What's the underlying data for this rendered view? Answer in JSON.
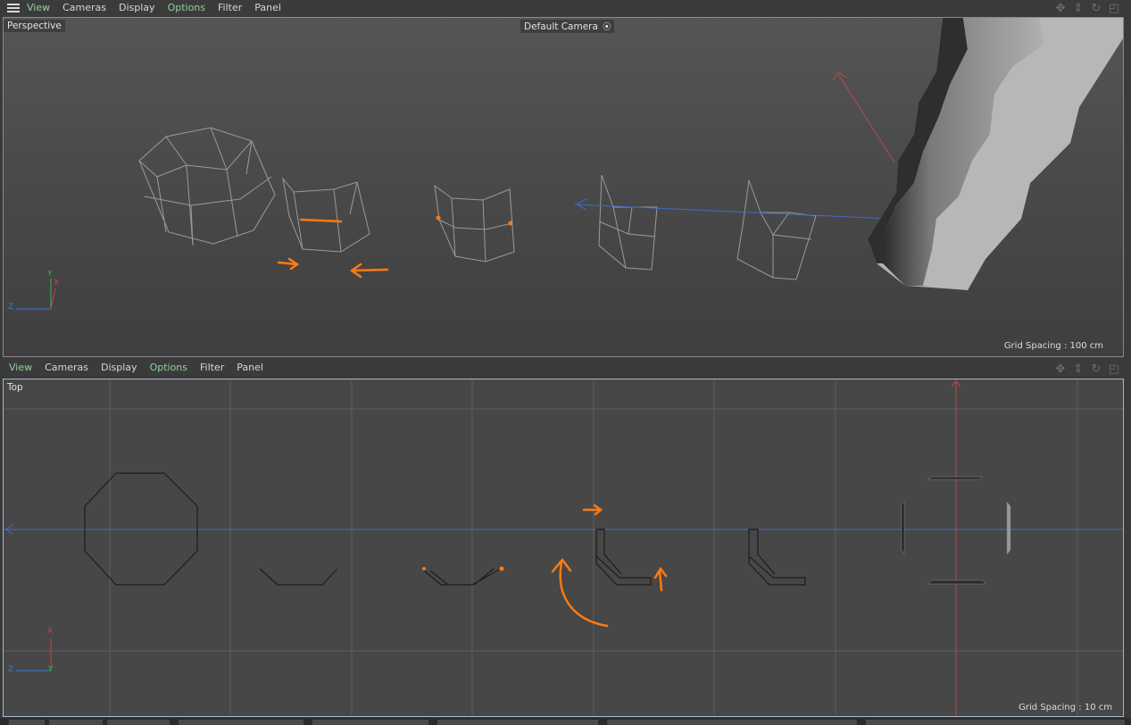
{
  "top_menu": {
    "items": [
      {
        "label": "View",
        "active": true
      },
      {
        "label": "Cameras",
        "active": false
      },
      {
        "label": "Display",
        "active": false
      },
      {
        "label": "Options",
        "active": true
      },
      {
        "label": "Filter",
        "active": false
      },
      {
        "label": "Panel",
        "active": false
      }
    ]
  },
  "bottom_menu": {
    "items": [
      {
        "label": "View",
        "active": true
      },
      {
        "label": "Cameras",
        "active": false
      },
      {
        "label": "Display",
        "active": false
      },
      {
        "label": "Options",
        "active": true
      },
      {
        "label": "Filter",
        "active": false
      },
      {
        "label": "Panel",
        "active": false
      }
    ]
  },
  "perspective": {
    "label": "Perspective",
    "camera": "Default Camera",
    "grid_spacing": "Grid Spacing : 100 cm",
    "axis": {
      "y": "Y",
      "x": "X",
      "z": "Z"
    }
  },
  "top_view": {
    "label": "Top",
    "grid_spacing": "Grid Spacing : 10 cm",
    "axis": {
      "x": "X",
      "y": "Y",
      "z": "Z"
    }
  },
  "colors": {
    "accent_orange": "#ff7a12",
    "active_menu": "#8fd29a",
    "axis_x": "#c0444e",
    "axis_y": "#3fb24d",
    "axis_z": "#3c78d0"
  },
  "nav_icons": [
    "move-icon",
    "dolly-icon",
    "rotate-icon",
    "maximize-icon"
  ]
}
